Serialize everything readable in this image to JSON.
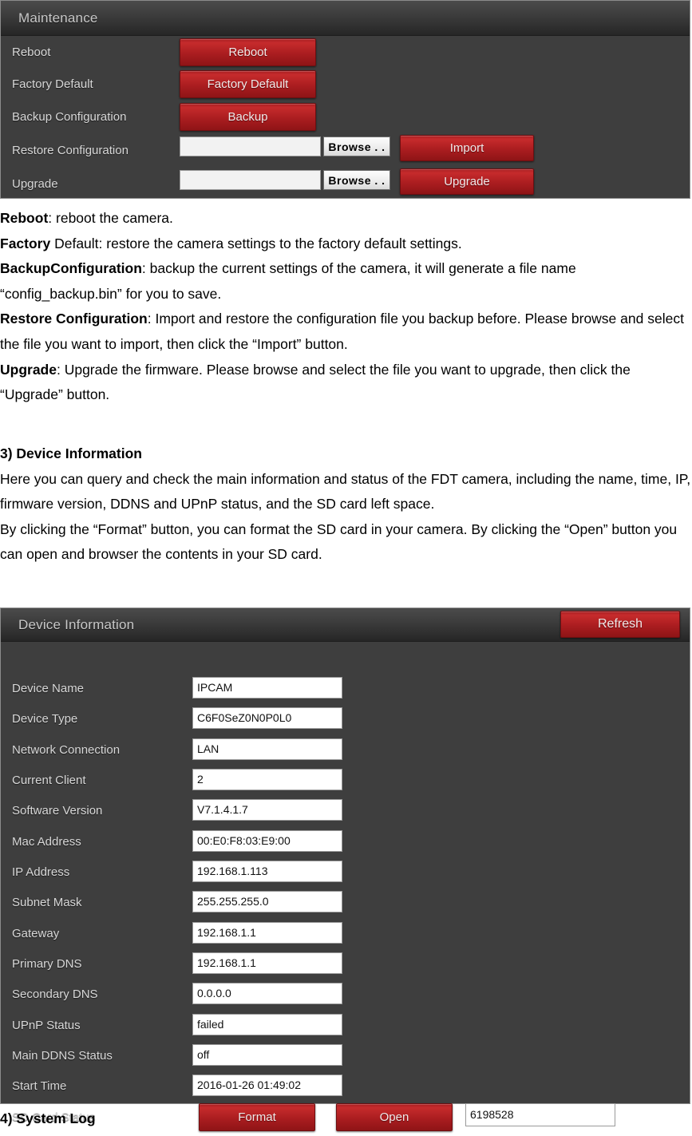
{
  "maintenance_panel": {
    "title": "Maintenance",
    "rows": [
      {
        "label": "Reboot",
        "button": "Reboot"
      },
      {
        "label": "Factory Default",
        "button": "Factory Default"
      },
      {
        "label": "Backup Configuration",
        "button": "Backup"
      },
      {
        "label": "Restore Configuration",
        "input_value": "",
        "browse": "Browse . .",
        "button": "Import"
      },
      {
        "label": "Upgrade",
        "input_value": "",
        "browse": "Browse . .",
        "button": "Upgrade"
      }
    ]
  },
  "maintenance_description": {
    "lines": [
      {
        "bold": "Reboot",
        "rest": ": reboot the camera."
      },
      {
        "bold": "Factory",
        "rest": " Default: restore the camera settings to the factory default settings."
      },
      {
        "bold": "BackupConfiguration",
        "rest": ": backup the current settings of the camera, it will generate a file name “config_backup.bin” for you to save."
      },
      {
        "bold": "Restore Configuration",
        "rest": ": Import and restore the configuration file you backup before. Please browse and select the file you want to import, then click the “Import” button."
      },
      {
        "bold": "Upgrade",
        "rest": ": Upgrade the firmware. Please browse and select the file you want to upgrade, then click the “Upgrade” button."
      }
    ]
  },
  "device_info_section": {
    "heading": "3) Device Information",
    "paragraph1": "Here you can query and check the main information and status of the FDT camera, including the name, time, IP, firmware version, DDNS and UPnP status, and the SD card left space.",
    "paragraph2": "By clicking the “Format” button, you can format the SD card in your camera. By clicking the “Open” button you can open and browser the contents in your SD card."
  },
  "device_info_panel": {
    "title": "Device Information",
    "refresh_button": "Refresh",
    "fields": [
      {
        "label": "Device Name",
        "value": "IPCAM"
      },
      {
        "label": "Device Type",
        "value": "C6F0SeZ0N0P0L0"
      },
      {
        "label": "Network Connection",
        "value": "LAN"
      },
      {
        "label": "Current Client",
        "value": "2"
      },
      {
        "label": "Software Version",
        "value": "V7.1.4.1.7"
      },
      {
        "label": "Mac Address",
        "value": "00:E0:F8:03:E9:00"
      },
      {
        "label": "IP Address",
        "value": "192.168.1.113"
      },
      {
        "label": "Subnet Mask",
        "value": "255.255.255.0"
      },
      {
        "label": "Gateway",
        "value": "192.168.1.1"
      },
      {
        "label": "Primary DNS",
        "value": "192.168.1.1"
      },
      {
        "label": "Secondary DNS",
        "value": "0.0.0.0"
      },
      {
        "label": "UPnP Status",
        "value": "failed"
      },
      {
        "label": "Main DDNS Status",
        "value": "off"
      },
      {
        "label": "Start Time",
        "value": "2016-01-26 01:49:02"
      }
    ],
    "sd_card_row": {
      "label": "SD Card Status",
      "format_button": "Format",
      "open_button": "Open",
      "free_space": "6198528"
    }
  },
  "system_log_section": {
    "heading": "4) System Log"
  },
  "colors": {
    "button_red": "#b3222a",
    "panel_bg": "#3e3e3e",
    "header_dark": "#2b2b2b",
    "label_text": "#d8d8d8"
  }
}
